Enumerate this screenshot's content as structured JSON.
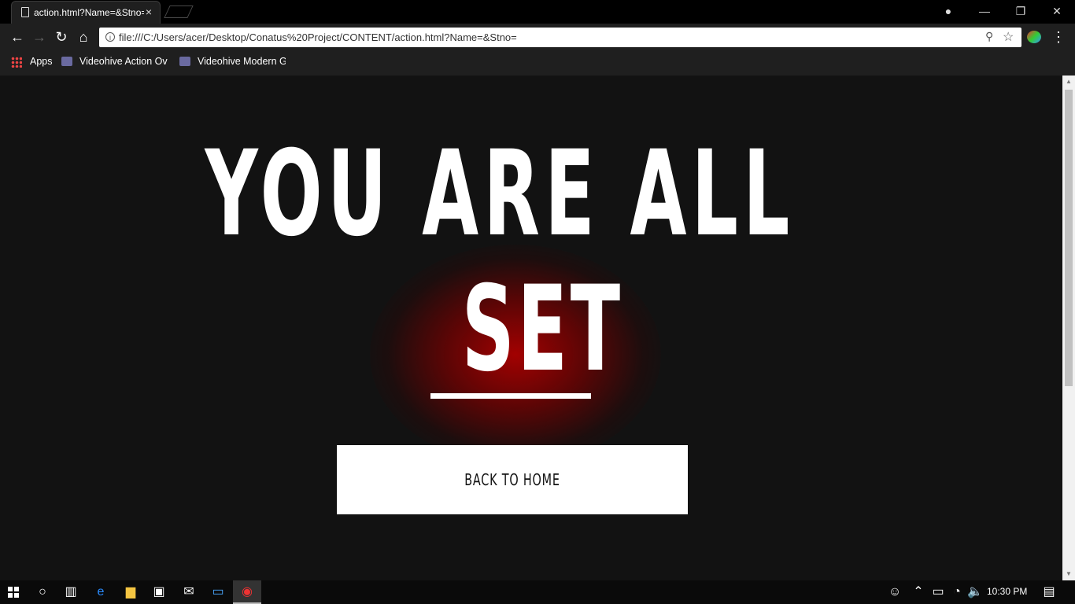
{
  "browser": {
    "tab_title": "action.html?Name=&Stno=",
    "tab_close": "×",
    "window_controls": {
      "minimize": "—",
      "restore": "❐",
      "close": "✕"
    },
    "url": "file:///C:/Users/acer/Desktop/Conatus%20Project/CONTENT/action.html?Name=&Stno=",
    "nav": {
      "back": "←",
      "forward": "→",
      "reload": "↻",
      "home": "⌂"
    },
    "bookmarks": [
      "Apps",
      "Videohive Action Ove",
      "Videohive Modern Gl"
    ]
  },
  "page": {
    "headline": "YOU ARE ALL",
    "highlight_word": "SET",
    "button_label": "BACK TO HOME",
    "accent_color": "#b00000"
  },
  "taskbar": {
    "clock": "10:30 PM",
    "icons": [
      "windows-start-icon",
      "cortana-icon",
      "task-view-icon",
      "edge-icon",
      "file-explorer-icon",
      "store-icon",
      "mail-icon",
      "remote-desktop-icon",
      "chrome-icon"
    ]
  }
}
